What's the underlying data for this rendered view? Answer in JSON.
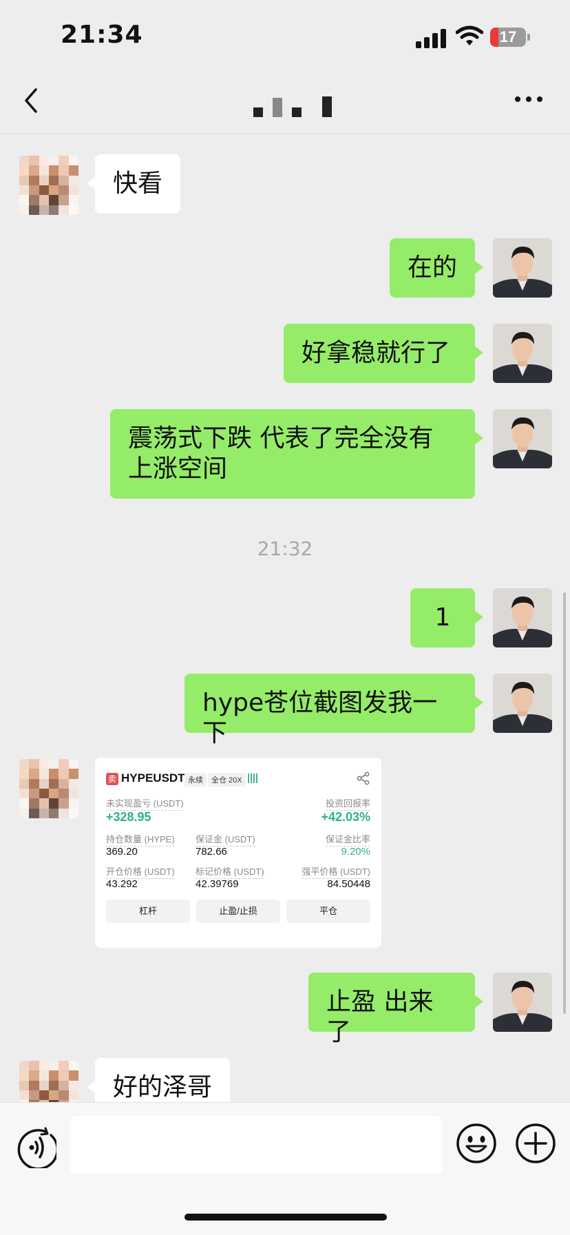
{
  "status_bar": {
    "time": "21:34",
    "battery": "17"
  },
  "nav": {
    "title": ""
  },
  "messages": [
    {
      "from": "other",
      "text": "快看"
    },
    {
      "from": "me",
      "text": "在的"
    },
    {
      "from": "me",
      "text": "好拿稳就行了"
    },
    {
      "from": "me",
      "text": "震荡式下跌 代表了完全没有上涨空间"
    },
    {
      "from": "me",
      "text": "1"
    },
    {
      "from": "me",
      "text": "hype苍位截图发我一下"
    },
    {
      "from": "me",
      "text": "止盈 出来了"
    },
    {
      "from": "other",
      "text": "好的泽哥"
    }
  ],
  "timestamp": "21:32",
  "trade_card": {
    "side": "卖",
    "symbol": "HYPEUSDT",
    "contract": "永续",
    "margin_mode": "全仓 20X",
    "unrealized_pnl_label": "未实现盈亏 (USDT)",
    "unrealized_pnl": "+328.95",
    "roi_label": "投资回报率",
    "roi": "+42.03%",
    "size_label": "持仓数量 (HYPE)",
    "size": "369.20",
    "margin_label": "保证金 (USDT)",
    "margin": "782.66",
    "margin_ratio_label": "保证金比率",
    "margin_ratio": "9.20%",
    "entry_label": "开仓价格 (USDT)",
    "entry": "43.292",
    "mark_label": "标记价格 (USDT)",
    "mark": "42.39769",
    "liq_label": "强平价格 (USDT)",
    "liq": "84.50448",
    "buttons": [
      "杠杆",
      "止盈/止损",
      "平仓"
    ]
  },
  "colors": {
    "bubble_me": "#95ec69",
    "bubble_other": "#ffffff",
    "profit_green": "#2eb37d"
  }
}
